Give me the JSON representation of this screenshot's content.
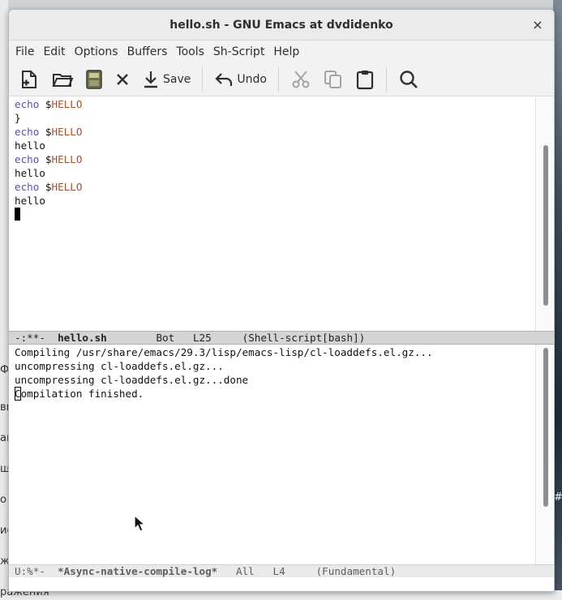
{
  "background": {
    "left_fragments": [
      "Ф",
      "вн",
      "ан",
      "ш",
      "о",
      "ие",
      "ж"
    ],
    "bottom_text": "ражения",
    "right_fragment": "#h"
  },
  "window": {
    "title": "hello.sh - GNU Emacs at dvdidenko",
    "close_label": "×"
  },
  "menu": [
    "File",
    "Edit",
    "Options",
    "Buffers",
    "Tools",
    "Sh-Script",
    "Help"
  ],
  "toolbar": {
    "icons": [
      "new-file-icon",
      "open-folder-icon",
      "save-buffer-icon",
      "close-buffer-icon",
      "save-icon",
      "undo-icon",
      "cut-icon",
      "copy-icon",
      "paste-icon",
      "search-icon"
    ],
    "save_label": "Save",
    "undo_label": "Undo"
  },
  "top_buffer": {
    "lines": [
      {
        "kw": "echo",
        "rest": " $",
        "var": "HELLO"
      },
      {
        "text": "}"
      },
      {
        "kw": "echo",
        "rest": " $",
        "var": "HELLO"
      },
      {
        "text": "hello"
      },
      {
        "kw": "echo",
        "rest": " $",
        "var": "HELLO"
      },
      {
        "text": "hello"
      },
      {
        "kw": "echo",
        "rest": " $",
        "var": "HELLO"
      },
      {
        "text": "hello"
      }
    ]
  },
  "top_modeline": {
    "status": "-:**-",
    "buffer_name": "hello.sh",
    "position": "Bot",
    "line": "L25",
    "mode": "(Shell-script[bash])"
  },
  "bottom_buffer": {
    "lines": [
      "Compiling /usr/share/emacs/29.3/lisp/emacs-lisp/cl-loaddefs.el.gz...",
      "uncompressing cl-loaddefs.el.gz...",
      "uncompressing cl-loaddefs.el.gz...done"
    ],
    "cursor_char": "C",
    "last_line_rest": "ompilation finished."
  },
  "bottom_modeline": {
    "status": "U:%*-",
    "buffer_name": "*Async-native-compile-log*",
    "position": "All",
    "line": "L4",
    "mode": "(Fundamental)"
  }
}
